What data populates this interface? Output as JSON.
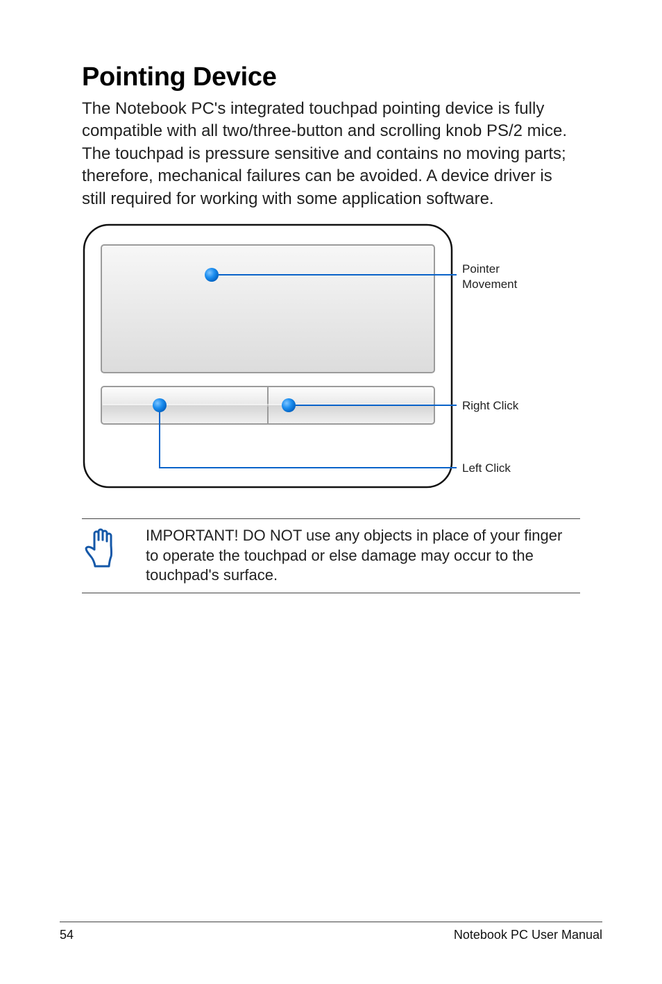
{
  "title": "Pointing Device",
  "intro": "The Notebook PC's integrated touchpad pointing device is fully compatible with all two/three-button and scrolling knob PS/2 mice. The touchpad is pressure sensitive and contains no moving parts; therefore, mechanical failures can be avoided. A device driver is still required for working with some application software.",
  "diagram": {
    "label_pointer_1": "Pointer",
    "label_pointer_2": "Movement",
    "label_right": "Right Click",
    "label_left": "Left Click"
  },
  "callout": "IMPORTANT! DO NOT use any objects in place of your finger to operate the touchpad or else damage may occur to the touchpad's surface.",
  "footer": {
    "page": "54",
    "doc": "Notebook PC User Manual"
  }
}
